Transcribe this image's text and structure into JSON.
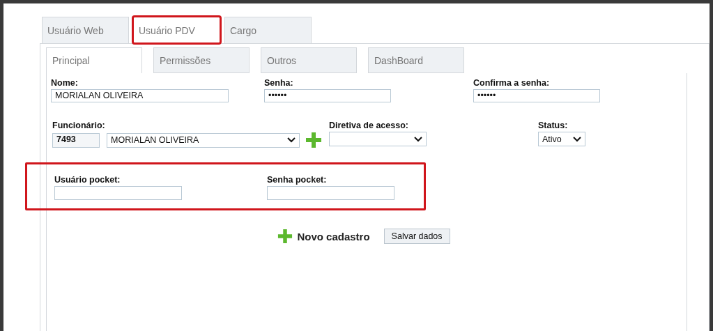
{
  "tabs": [
    {
      "label": "Usuário Web",
      "selected": false,
      "highlighted": false
    },
    {
      "label": "Usuário PDV",
      "selected": true,
      "highlighted": true
    },
    {
      "label": "Cargo",
      "selected": false,
      "highlighted": false
    }
  ],
  "subtabs": [
    {
      "label": "Principal",
      "selected": true
    },
    {
      "label": "Permissões",
      "selected": false
    },
    {
      "label": "Outros",
      "selected": false
    },
    {
      "label": "DashBoard",
      "selected": false
    }
  ],
  "row1": [
    {
      "label": "Nome:",
      "value": "MORIALAN OLIVEIRA"
    },
    {
      "label": "Senha:",
      "value": "••••••"
    },
    {
      "label": "Confirma a senha:",
      "value": "••••••"
    }
  ],
  "funcionario": {
    "label": "Funcionário:",
    "code": "7493",
    "value": "MORIALAN OLIVEIRA"
  },
  "diretiva": {
    "label": "Diretiva de acesso:"
  },
  "status": {
    "label": "Status:",
    "value": "Ativo"
  },
  "pocket": {
    "highlighted": true,
    "fields": [
      {
        "label": "Usuário pocket:"
      },
      {
        "label": "Senha pocket:"
      }
    ]
  },
  "actions": {
    "new": "Novo cadastro",
    "save": "Salvar dados"
  }
}
